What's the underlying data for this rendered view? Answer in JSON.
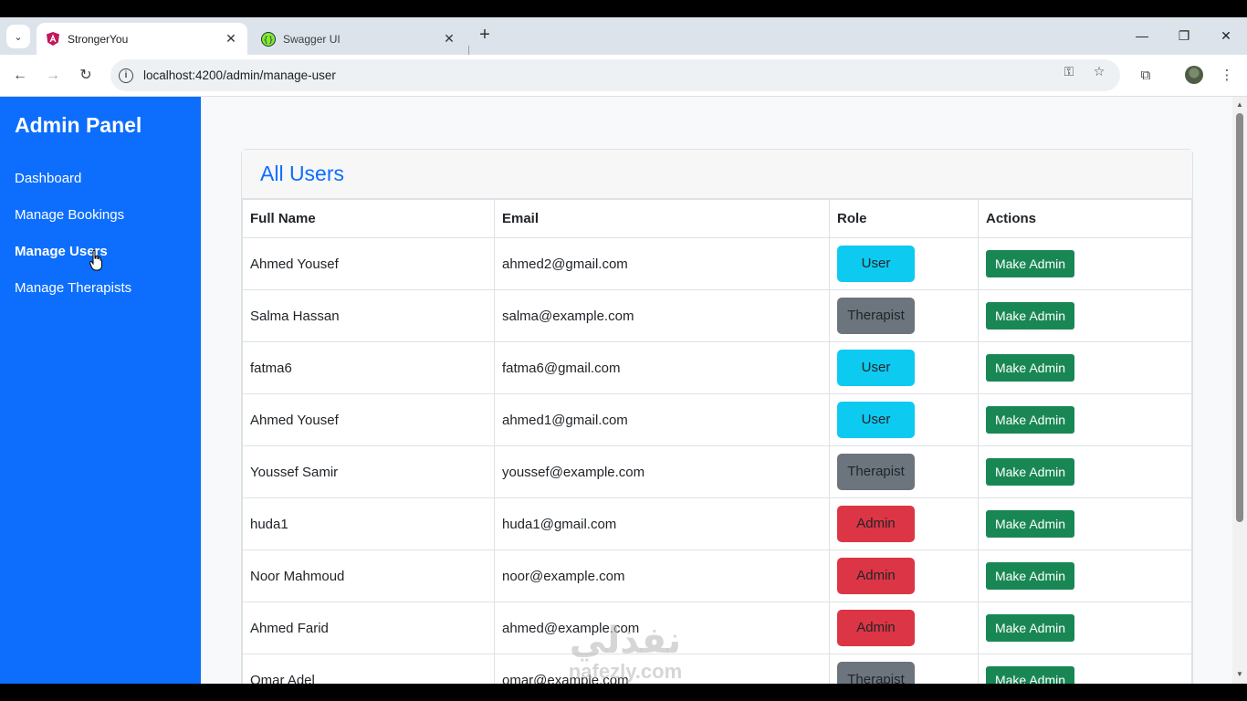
{
  "browser": {
    "tabs": [
      {
        "title": "StrongerYou",
        "active": true
      },
      {
        "title": "Swagger UI",
        "active": false
      }
    ],
    "url": "localhost:4200/admin/manage-user"
  },
  "sidebar": {
    "brand": "Admin Panel",
    "items": [
      {
        "label": "Dashboard",
        "active": false
      },
      {
        "label": "Manage Bookings",
        "active": false
      },
      {
        "label": "Manage Users",
        "active": true
      },
      {
        "label": "Manage Therapists",
        "active": false
      }
    ]
  },
  "main": {
    "title": "All Users",
    "columns": [
      "Full Name",
      "Email",
      "Role",
      "Actions"
    ],
    "action_label": "Make Admin",
    "rows": [
      {
        "name": "Ahmed Yousef",
        "email": "ahmed2@gmail.com",
        "role": "User"
      },
      {
        "name": "Salma Hassan",
        "email": "salma@example.com",
        "role": "Therapist"
      },
      {
        "name": "fatma6",
        "email": "fatma6@gmail.com",
        "role": "User"
      },
      {
        "name": "Ahmed Yousef",
        "email": "ahmed1@gmail.com",
        "role": "User"
      },
      {
        "name": "Youssef Samir",
        "email": "youssef@example.com",
        "role": "Therapist"
      },
      {
        "name": "huda1",
        "email": "huda1@gmail.com",
        "role": "Admin"
      },
      {
        "name": "Noor Mahmoud",
        "email": "noor@example.com",
        "role": "Admin"
      },
      {
        "name": "Ahmed Farid",
        "email": "ahmed@example.com",
        "role": "Admin"
      },
      {
        "name": "Omar Adel",
        "email": "omar@example.com",
        "role": "Therapist"
      }
    ]
  },
  "colors": {
    "primary": "#0d6efd",
    "user_badge": "#0dcaf0",
    "therapist_badge": "#6c757d",
    "admin_badge": "#dc3545",
    "action_button": "#198754"
  },
  "watermark": {
    "arabic": "نفذلي",
    "latin": "nafezly.com"
  }
}
